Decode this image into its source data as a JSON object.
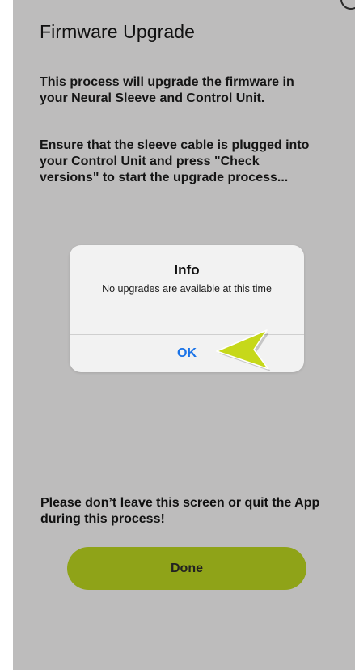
{
  "screen": {
    "title": "Firmware Upgrade",
    "intro": "This process will upgrade the firmware in your Neural Sleeve and Control Unit.",
    "instructions": "Ensure that the sleeve cable is plugged into your Control Unit and press \"Check versions\" to start the upgrade process...",
    "warning": "Please don’t leave this screen or quit the App during this process!",
    "done_label": "Done"
  },
  "dialog": {
    "title": "Info",
    "message": "No upgrades are available at this time",
    "ok_label": "OK"
  },
  "colors": {
    "screen_background": "#bdbcbc",
    "dialog_background": "#f2f2f2",
    "dialog_button_text": "#1a73e8",
    "done_button": "#8fa318",
    "pointer_arrow": "#c6d81a"
  },
  "icons": {
    "corner": "circle-icon",
    "pointer": "pointer-arrow-icon"
  }
}
